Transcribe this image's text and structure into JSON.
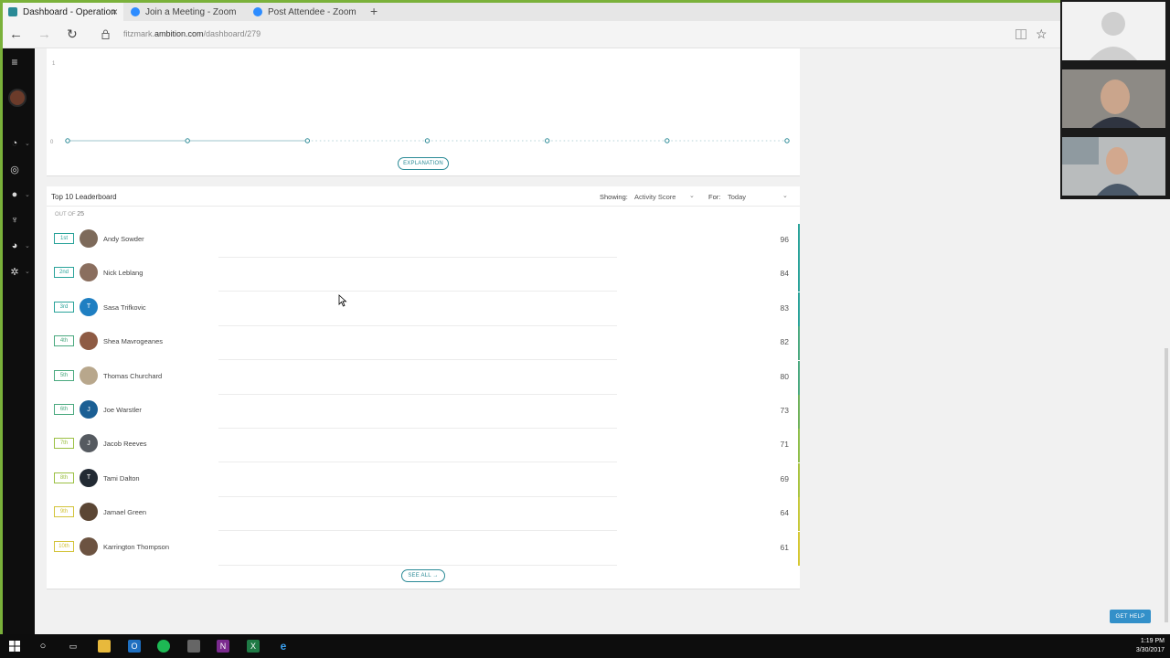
{
  "browser": {
    "tabs": [
      {
        "label": "Dashboard - Operation",
        "active": true,
        "favicon_color": "#2a8a96"
      },
      {
        "label": "Join a Meeting - Zoom",
        "active": false,
        "favicon_color": "#2d8cff"
      },
      {
        "label": "Post Attendee - Zoom",
        "active": false,
        "favicon_color": "#2d8cff"
      }
    ],
    "new_tab_label": "+",
    "url_prefix": "fitzmark.",
    "url_domain": "ambition.com",
    "url_path": "/dashboard/279"
  },
  "chart": {
    "y_top_label": "1",
    "y_zero_label": "0",
    "points": [
      0,
      0,
      0,
      0,
      0,
      0,
      0
    ],
    "explanation_label": "EXPLANATION"
  },
  "leaderboard": {
    "title": "Top 10 Leaderboard",
    "showing_label": "Showing:",
    "showing_value": "Activity Score",
    "for_label": "For:",
    "for_value": "Today",
    "out_of_label": "OUT OF",
    "out_of_count": "25",
    "rows": [
      {
        "rank": "1st",
        "name": "Andy Sowder",
        "score": "96",
        "initial": "",
        "avatar_color": "#7d6a5a",
        "bar_color": "#2aa39a"
      },
      {
        "rank": "2nd",
        "name": "Nick Leblang",
        "score": "84",
        "initial": "",
        "avatar_color": "#8a6e5e",
        "bar_color": "#2aa39a"
      },
      {
        "rank": "3rd",
        "name": "Sasa Trifkovic",
        "score": "83",
        "initial": "T",
        "avatar_color": "#1f7fc2",
        "bar_color": "#2aa39a"
      },
      {
        "rank": "4th",
        "name": "Shea Mavrogeanes",
        "score": "82",
        "initial": "",
        "avatar_color": "#8e5b44",
        "bar_color": "#4aa97f"
      },
      {
        "rank": "5th",
        "name": "Thomas Churchard",
        "score": "80",
        "initial": "",
        "avatar_color": "#b8a78c",
        "bar_color": "#4aa97f"
      },
      {
        "rank": "6th",
        "name": "Joe Warstler",
        "score": "73",
        "initial": "J",
        "avatar_color": "#1b5f94",
        "bar_color": "#6fb25a"
      },
      {
        "rank": "7th",
        "name": "Jacob Reeves",
        "score": "71",
        "initial": "J",
        "avatar_color": "#555a60",
        "bar_color": "#8fbf4a"
      },
      {
        "rank": "8th",
        "name": "Tami Dalton",
        "score": "69",
        "initial": "T",
        "avatar_color": "#222a33",
        "bar_color": "#a9c43f"
      },
      {
        "rank": "9th",
        "name": "Jamael Green",
        "score": "64",
        "initial": "",
        "avatar_color": "#5b4634",
        "bar_color": "#c7c93a"
      },
      {
        "rank": "10th",
        "name": "Karrington Thompson",
        "score": "61",
        "initial": "",
        "avatar_color": "#6c5341",
        "bar_color": "#d6c832"
      }
    ],
    "see_all_label": "SEE ALL →"
  },
  "get_help_label": "GET HELP",
  "clock": {
    "time": "1:19 PM",
    "date": "3/30/2017"
  },
  "colors": {
    "accent": "#2a8a96",
    "help": "#3390c9",
    "frame": "#7ab13a"
  }
}
